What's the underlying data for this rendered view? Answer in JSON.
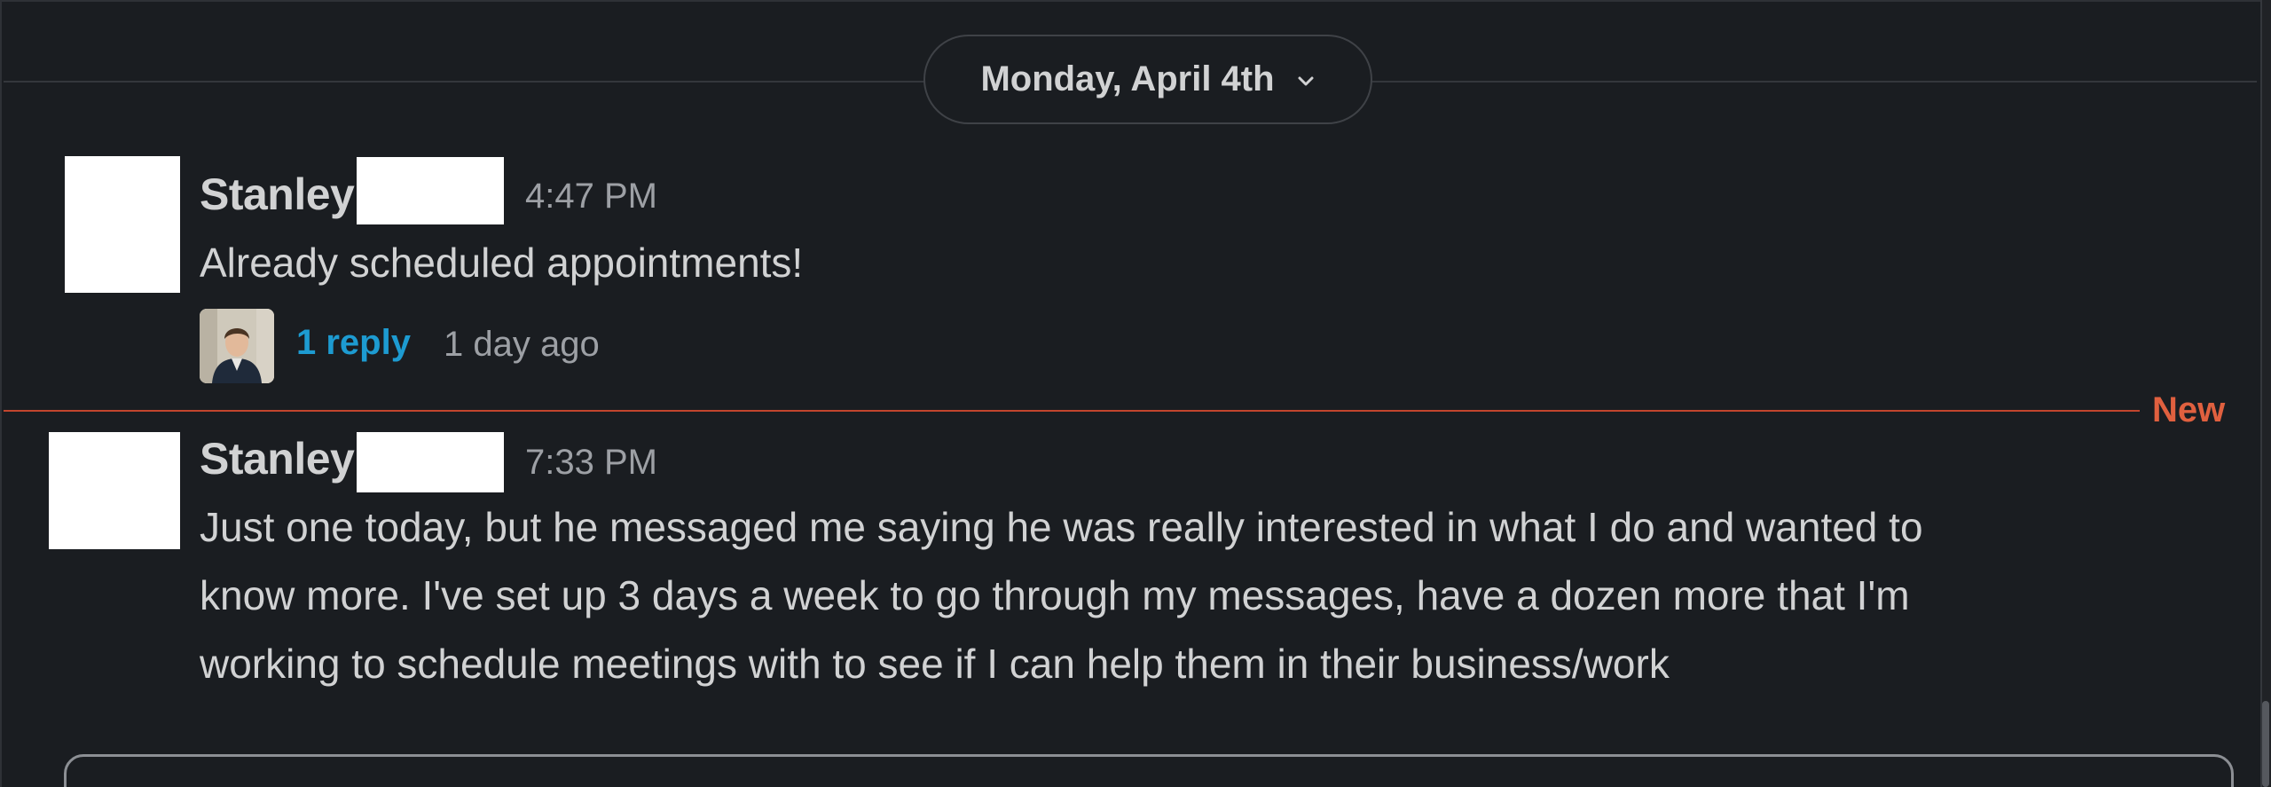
{
  "date_divider": {
    "label": "Monday, April 4th",
    "chevron_icon": "chevron-down-icon"
  },
  "messages": [
    {
      "sender": "Stanley",
      "time": "4:47 PM",
      "text": "Already scheduled appointments!",
      "thread": {
        "reply_count": "1 reply",
        "last_reply": "1 day ago",
        "avatar_icon": "user-photo-avatar"
      }
    },
    {
      "sender": "Stanley",
      "time": "7:33 PM",
      "text_lines": [
        "Just one today, but he messaged me saying he was really interested in what I do and wanted to",
        "know more. I've set up 3 days a week to go through my messages, have a dozen more that I'm",
        "working to schedule meetings with to see if I can help them in their business/work"
      ]
    }
  ],
  "new_divider": {
    "label": "New"
  },
  "colors": {
    "background": "#1a1d21",
    "text": "#d1d2d3",
    "muted": "#9da0a5",
    "link": "#1d9bd1",
    "new_marker": "#e0603f"
  }
}
